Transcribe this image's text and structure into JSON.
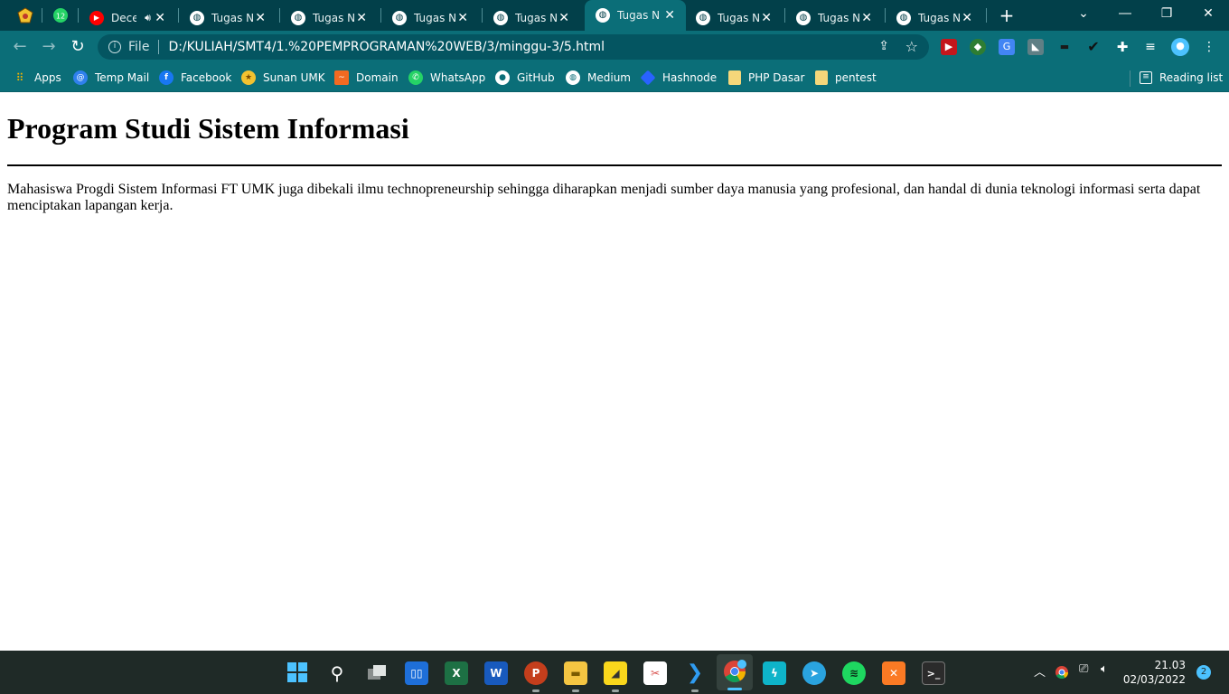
{
  "browser": {
    "tabs": [
      {
        "title": "Dece",
        "favicon": "youtube-icon",
        "audio": true
      },
      {
        "title": "Tugas N",
        "favicon": "globe-icon"
      },
      {
        "title": "Tugas N",
        "favicon": "globe-icon"
      },
      {
        "title": "Tugas N",
        "favicon": "globe-icon"
      },
      {
        "title": "Tugas N",
        "favicon": "globe-icon"
      },
      {
        "title": "Tugas N",
        "favicon": "globe-icon",
        "active": true
      },
      {
        "title": "Tugas N",
        "favicon": "globe-icon"
      },
      {
        "title": "Tugas N",
        "favicon": "globe-icon"
      },
      {
        "title": "Tugas N",
        "favicon": "globe-icon"
      }
    ],
    "pinned_tabs": [
      {
        "icon": "umk-logo-icon"
      },
      {
        "icon": "whatsapp-icon",
        "badge": "12"
      }
    ],
    "new_tab_label": "+",
    "address_bar": {
      "scheme_label": "File",
      "url": "D:/KULIAH/SMT4/1.%20PEMPROGRAMAN%20WEB/3/minggu-3/5.html"
    },
    "bookmarks": [
      {
        "label": "Apps",
        "icon": "apps-grid-icon"
      },
      {
        "label": "Temp Mail",
        "icon": "at-sign-icon"
      },
      {
        "label": "Facebook",
        "icon": "facebook-icon"
      },
      {
        "label": "Sunan UMK",
        "icon": "umk-logo-icon"
      },
      {
        "label": "Domain",
        "icon": "domain-icon"
      },
      {
        "label": "WhatsApp",
        "icon": "whatsapp-icon"
      },
      {
        "label": "GitHub",
        "icon": "github-icon"
      },
      {
        "label": "Medium",
        "icon": "globe-icon"
      },
      {
        "label": "Hashnode",
        "icon": "hashnode-icon"
      },
      {
        "label": "PHP Dasar",
        "icon": "folder-icon"
      },
      {
        "label": "pentest",
        "icon": "folder-icon"
      }
    ],
    "reading_list_label": "Reading list",
    "colors": {
      "frame": "#02404a",
      "toolbar": "#0b6e78",
      "omnibox": "#045561"
    }
  },
  "page": {
    "heading": "Program Studi Sistem Informasi",
    "paragraph": "Mahasiswa Progdi Sistem Informasi FT UMK juga dibekali ilmu technopreneurship sehingga diharapkan menjadi sumber daya manusia yang profesional, dan handal di dunia teknologi informasi serta dapat menciptakan lapangan kerja."
  },
  "taskbar": {
    "apps": [
      "windows-start-icon",
      "search-icon",
      "task-view-icon",
      "widgets-icon",
      "excel-icon",
      "word-icon",
      "powerpoint-icon",
      "file-explorer-icon",
      "sticky-notes-icon",
      "snipping-tool-icon",
      "vscode-icon",
      "chrome-icon",
      "sourcetree-icon",
      "telegram-icon",
      "spotify-icon",
      "xampp-icon",
      "terminal-icon"
    ],
    "clock_time": "21.03",
    "clock_date": "02/03/2022",
    "notification_count": "2"
  }
}
